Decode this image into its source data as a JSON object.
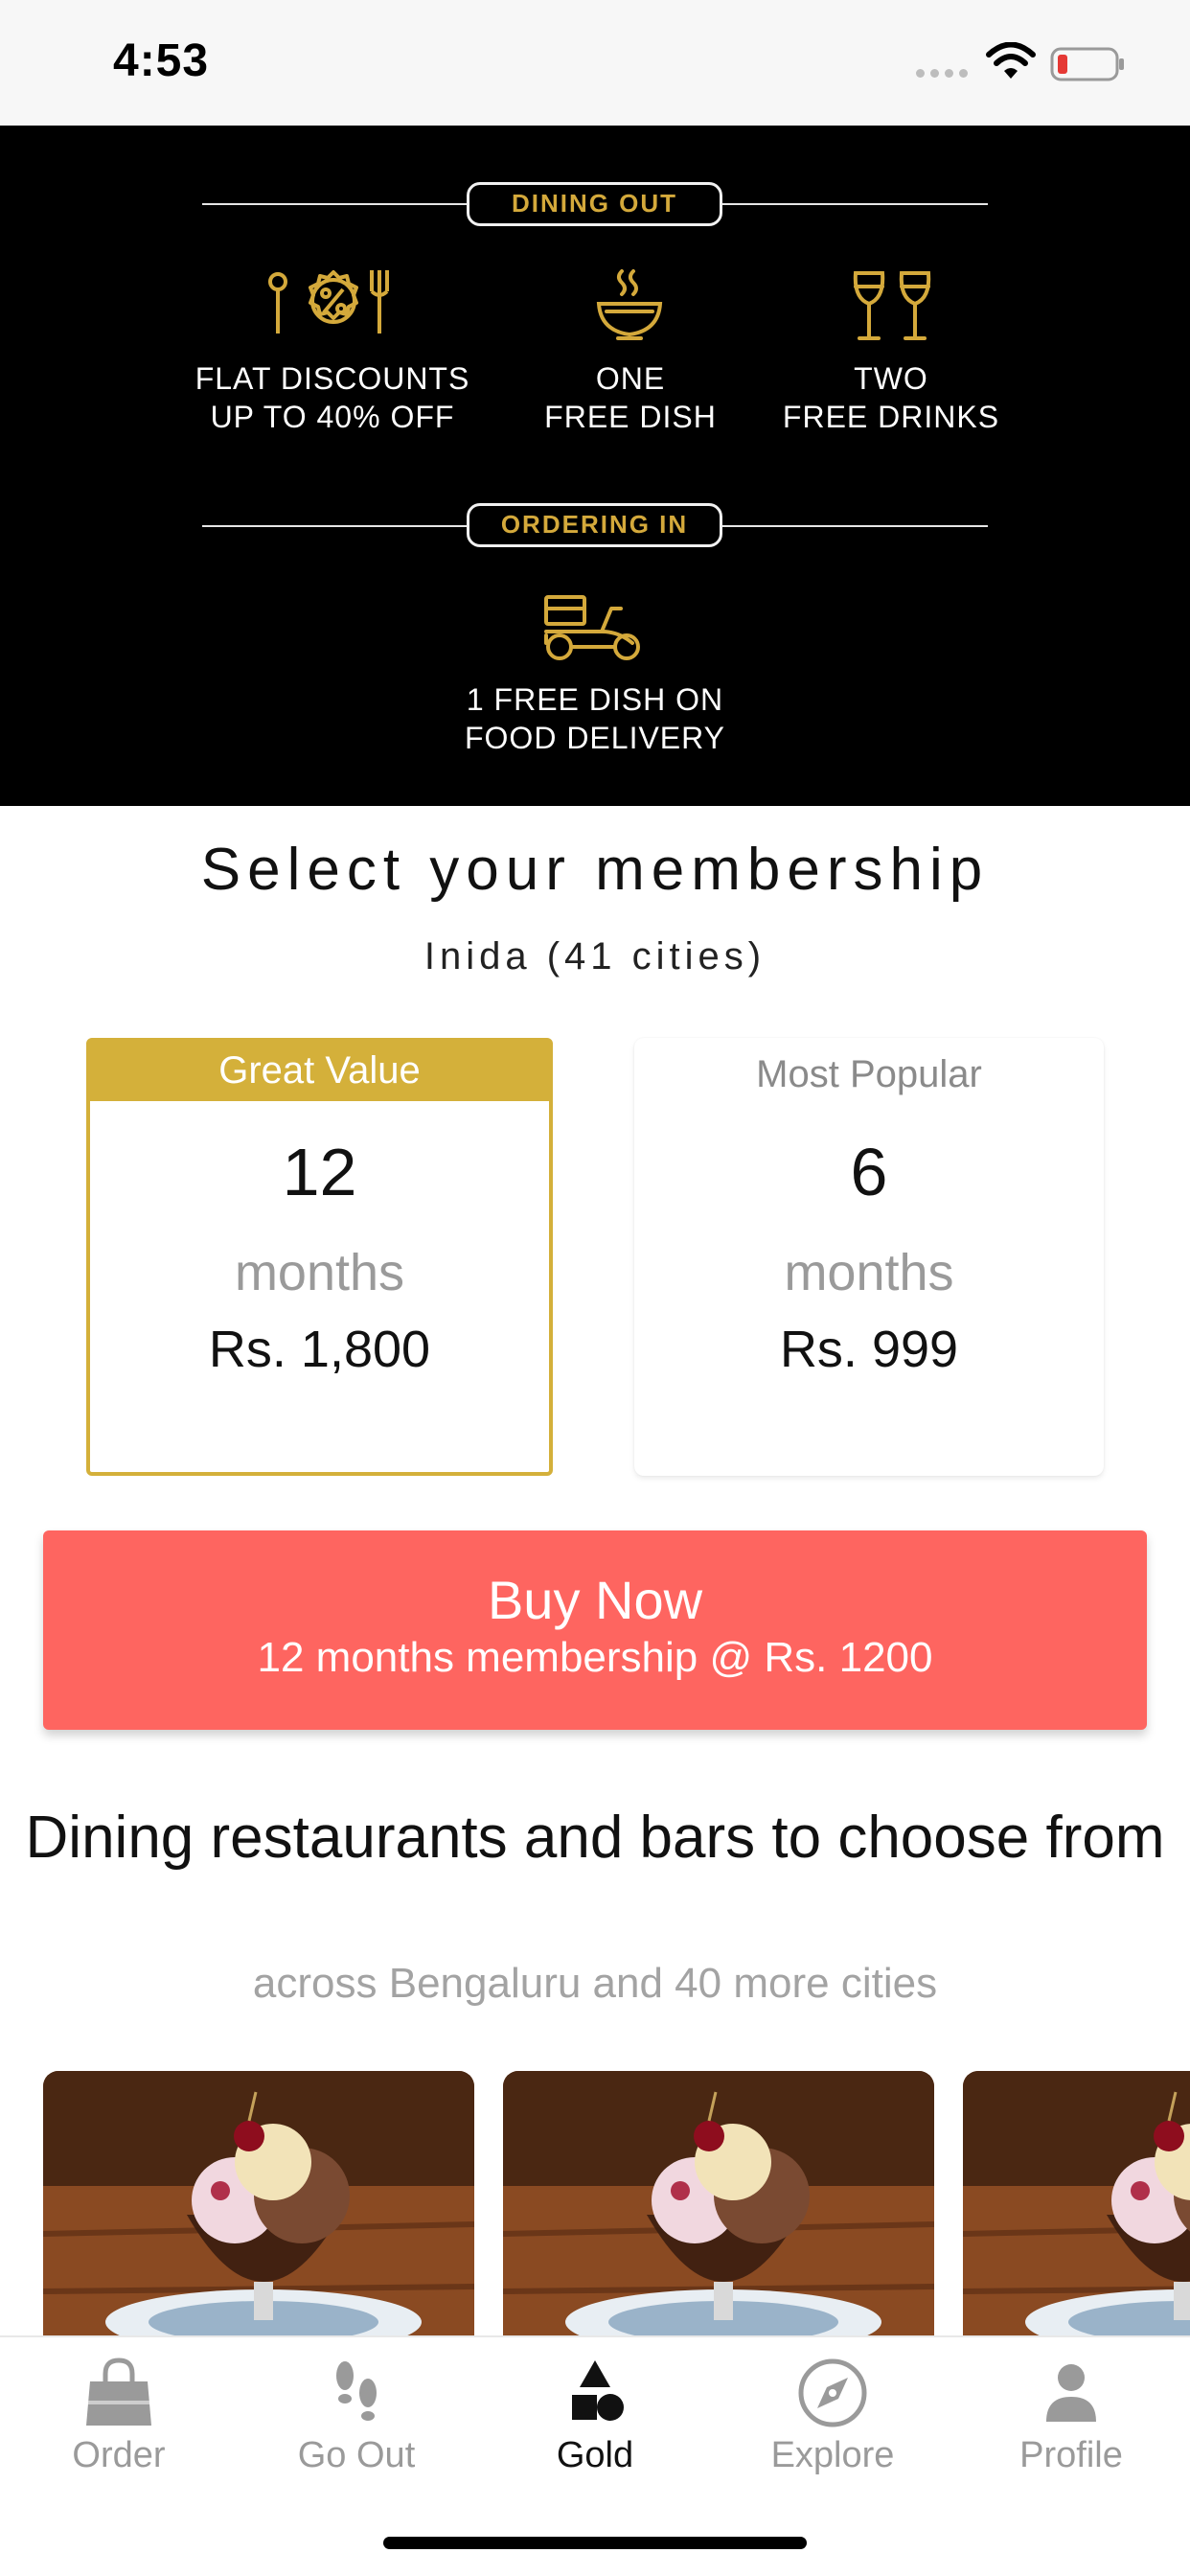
{
  "status_bar": {
    "time": "4:53",
    "icons": [
      "signal-dots-icon",
      "wifi-icon",
      "battery-low-icon"
    ],
    "battery_color": "#e53935"
  },
  "gold_banner": {
    "dining_out_label": "DINING OUT",
    "ordering_in_label": "ORDERING IN",
    "benefits": [
      {
        "icon": "discount-cutlery-icon",
        "text": "FLAT DISCOUNTS\nUP TO 40% OFF"
      },
      {
        "icon": "bowl-icon",
        "text": "ONE\nFREE DISH"
      },
      {
        "icon": "wine-glasses-icon",
        "text": "TWO\nFREE DRINKS"
      }
    ],
    "delivery": {
      "icon": "delivery-scooter-icon",
      "text": "1 FREE DISH ON\nFOOD DELIVERY"
    },
    "accent_color": "#d4a93b"
  },
  "membership": {
    "title": "Select your membership",
    "region": "Inida (41 cities)",
    "plans": [
      {
        "tag": "Great Value",
        "duration": "12",
        "unit": "months",
        "price": "Rs. 1,800",
        "selected": true
      },
      {
        "tag": "Most Popular",
        "duration": "6",
        "unit": "months",
        "price": "Rs. 999",
        "selected": false
      }
    ],
    "selected_color": "#d4b03a"
  },
  "buy_button": {
    "title": "Buy Now",
    "subtitle": "12 months membership @ Rs. 1200",
    "color": "#fe6560"
  },
  "dining": {
    "title": "Dining restaurants and bars to choose from",
    "subtitle": "across Bengaluru and 40 more cities",
    "cards": [
      {
        "image": "ice-cream-sundae-photo"
      },
      {
        "image": "ice-cream-sundae-photo"
      },
      {
        "image": "ice-cream-sundae-photo"
      }
    ]
  },
  "tabbar": {
    "tabs": [
      {
        "label": "Order",
        "icon": "shopping-bag-icon",
        "active": false
      },
      {
        "label": "Go Out",
        "icon": "footsteps-icon",
        "active": false
      },
      {
        "label": "Gold",
        "icon": "shapes-icon",
        "active": true
      },
      {
        "label": "Explore",
        "icon": "compass-icon",
        "active": false
      },
      {
        "label": "Profile",
        "icon": "person-icon",
        "active": false
      }
    ]
  }
}
